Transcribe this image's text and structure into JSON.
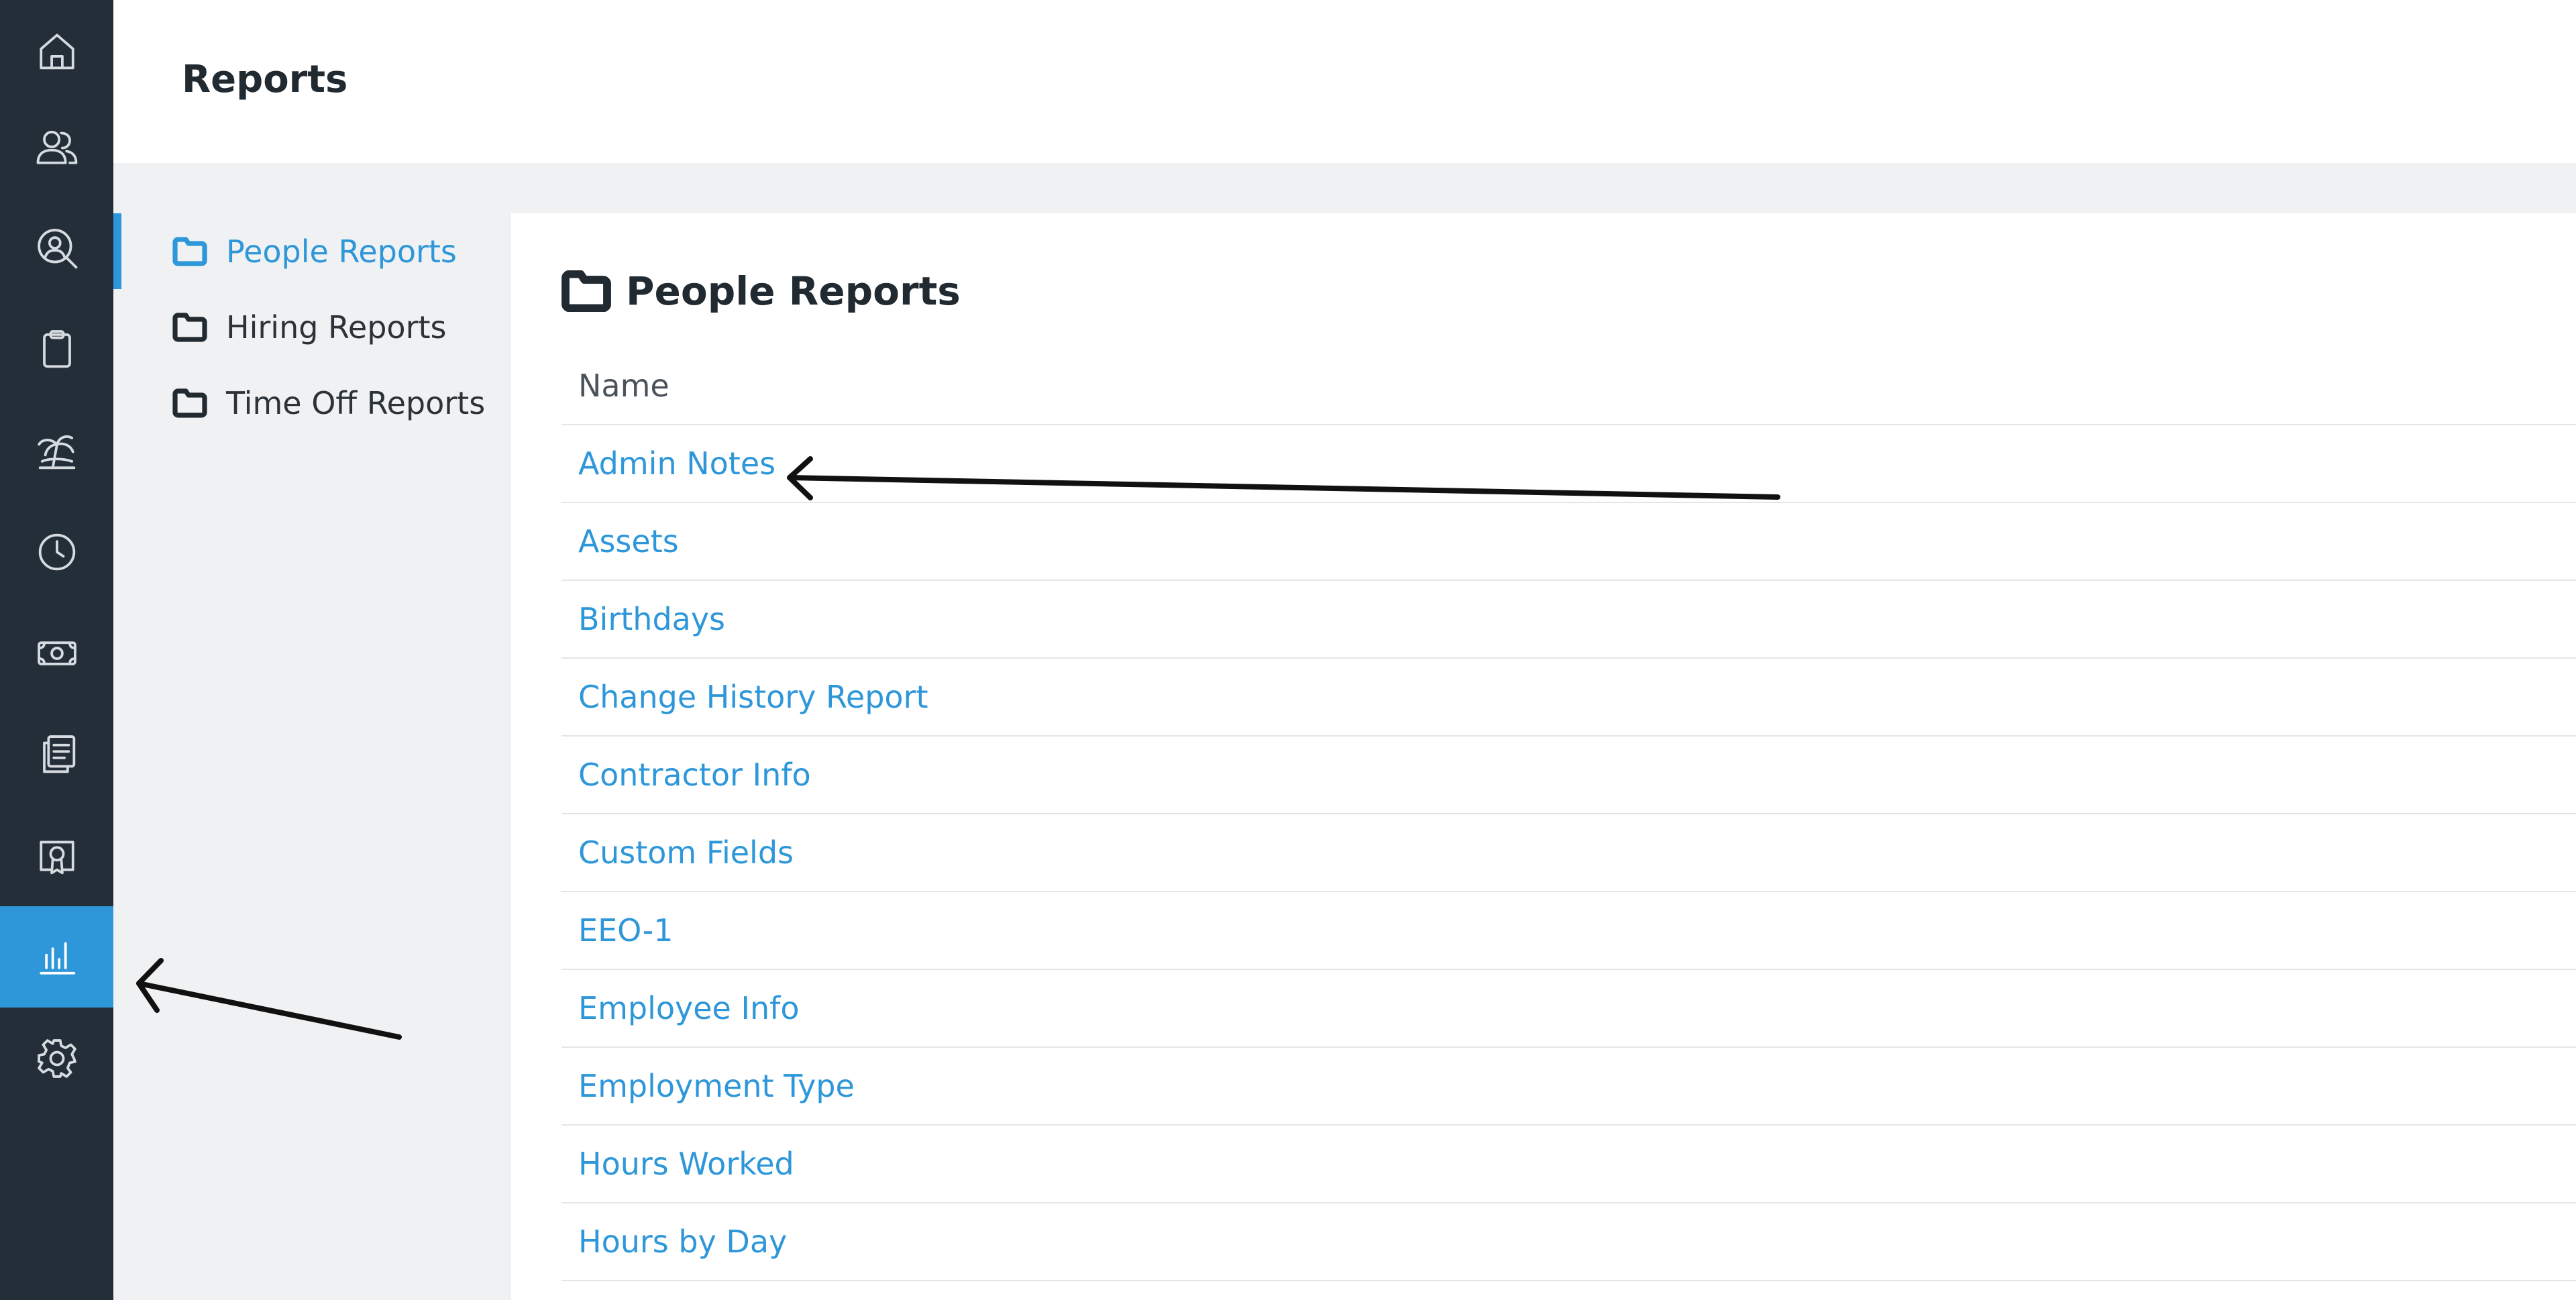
{
  "rail": {
    "items": [
      {
        "icon": "home-icon",
        "active": false
      },
      {
        "icon": "people-icon",
        "active": false
      },
      {
        "icon": "person-search-icon",
        "active": false
      },
      {
        "icon": "clipboard-icon",
        "active": false
      },
      {
        "icon": "palm-tree-icon",
        "active": false
      },
      {
        "icon": "clock-icon",
        "active": false
      },
      {
        "icon": "money-icon",
        "active": false
      },
      {
        "icon": "documents-icon",
        "active": false
      },
      {
        "icon": "certificate-icon",
        "active": false
      },
      {
        "icon": "bar-chart-icon",
        "active": true
      },
      {
        "icon": "gear-icon",
        "active": false
      }
    ]
  },
  "header": {
    "title": "Reports"
  },
  "subnav": {
    "items": [
      {
        "label": "People Reports",
        "active": true
      },
      {
        "label": "Hiring Reports",
        "active": false
      },
      {
        "label": "Time Off Reports",
        "active": false
      }
    ]
  },
  "main": {
    "title": "People Reports",
    "column_header": "Name",
    "rows": [
      "Admin Notes",
      "Assets",
      "Birthdays",
      "Change History Report",
      "Contractor Info",
      "Custom Fields",
      "EEO-1",
      "Employee Info",
      "Employment Type",
      "Hours Worked",
      "Hours by Day"
    ]
  },
  "colors": {
    "accent": "#2e97d9",
    "rail_background": "#232e38",
    "page_background": "#f0f1f2"
  }
}
